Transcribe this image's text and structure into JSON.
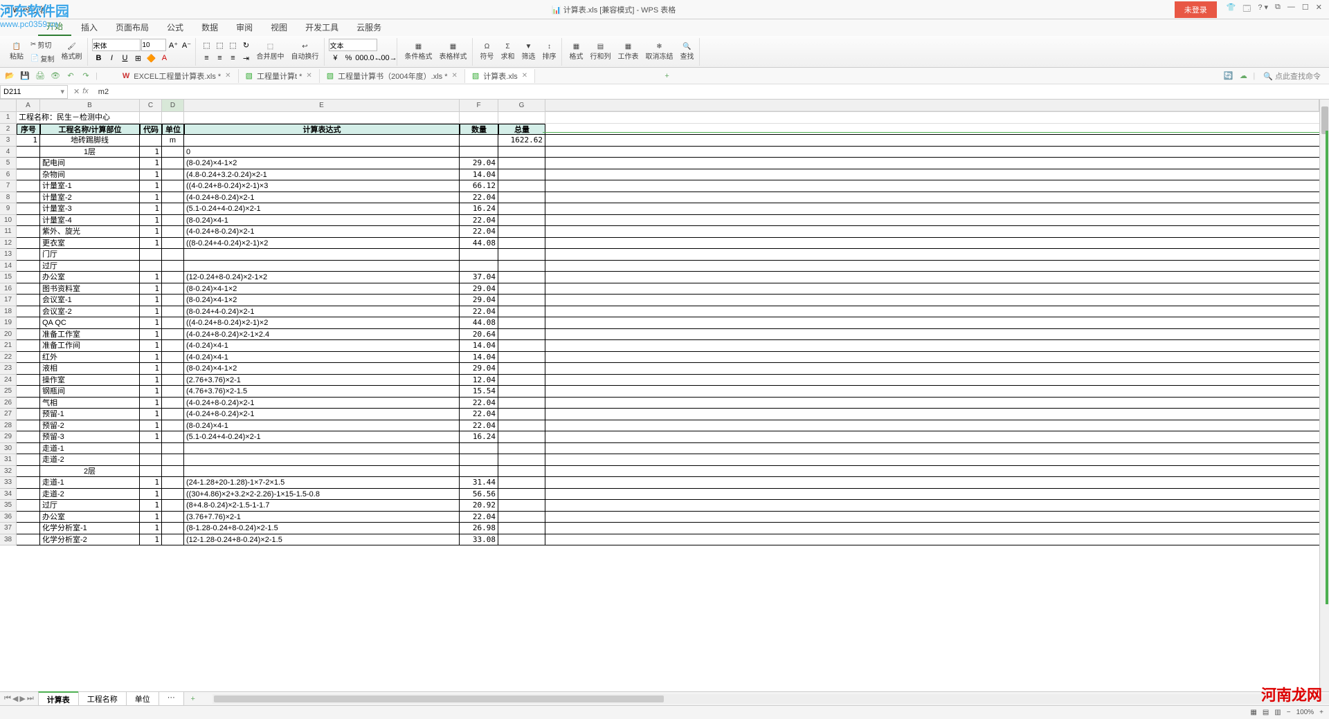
{
  "watermark": "河东软件园",
  "watermark_url": "www.pc0359.cn",
  "watermark_br": "河南龙网",
  "app_label": "WPS 表格",
  "title": "计算表.xls [兼容模式] - WPS 表格",
  "login": "未登录",
  "menutabs": [
    "开始",
    "插入",
    "页面布局",
    "公式",
    "数据",
    "审阅",
    "视图",
    "开发工具",
    "云服务"
  ],
  "menutab_active": 0,
  "ribbon": {
    "paste": "粘贴",
    "cut": "剪切",
    "copy": "复制",
    "fmtpaint": "格式刷",
    "font": "宋体",
    "size": "10",
    "merge": "合并居中",
    "autowrap": "自动换行",
    "general": "文本",
    "cond": "条件格式",
    "tblstyle": "表格样式",
    "symbol": "符号",
    "sum": "求和",
    "filter": "筛选",
    "sort": "排序",
    "format": "格式",
    "rowcol": "行和列",
    "worksheet": "工作表",
    "freeze": "取消冻结",
    "find": "查找"
  },
  "quick_icons": [
    "folder",
    "save",
    "print",
    "preview",
    "undo",
    "redo"
  ],
  "doctabs": [
    {
      "icon": "W",
      "label": "EXCEL工程量计算表.xls *",
      "active": false
    },
    {
      "icon": "S",
      "label": "工程量计算t *",
      "active": false
    },
    {
      "icon": "S",
      "label": "工程量计算书（2004年度）.xls *",
      "active": false
    },
    {
      "icon": "S",
      "label": "计算表.xls",
      "active": true
    }
  ],
  "search_placeholder": "点此查找命令",
  "namebox": "D211",
  "formula": "m2",
  "cols": [
    "A",
    "B",
    "C",
    "D",
    "E",
    "F",
    "G"
  ],
  "headers": {
    "A": "序号",
    "B": "工程名称/计算部位",
    "C": "代码",
    "D": "单位",
    "E": "计算表达式",
    "F": "数量",
    "G": "总量"
  },
  "title_row": "工程名称：民生－检测中心",
  "rows": [
    {
      "n": 3,
      "A": "1",
      "B": "地砖踢脚线",
      "D": "m",
      "E": "",
      "G": "1622.62"
    },
    {
      "n": 4,
      "B": "1层",
      "C": "1",
      "E": "0"
    },
    {
      "n": 5,
      "B": "配电间",
      "C": "1",
      "E": "(8-0.24)×4-1×2",
      "F": "29.04"
    },
    {
      "n": 6,
      "B": "杂物间",
      "C": "1",
      "E": "(4.8-0.24+3.2-0.24)×2-1",
      "F": "14.04"
    },
    {
      "n": 7,
      "B": "计量室-1",
      "C": "1",
      "E": "((4-0.24+8-0.24)×2-1)×3",
      "F": "66.12"
    },
    {
      "n": 8,
      "B": "计量室-2",
      "C": "1",
      "E": "(4-0.24+8-0.24)×2-1",
      "F": "22.04"
    },
    {
      "n": 9,
      "B": "计量室-3",
      "C": "1",
      "E": "(5.1-0.24+4-0.24)×2-1",
      "F": "16.24"
    },
    {
      "n": 10,
      "B": "计量室-4",
      "C": "1",
      "E": "(8-0.24)×4-1",
      "F": "22.04"
    },
    {
      "n": 11,
      "B": "紫外、旋光",
      "C": "1",
      "E": "(4-0.24+8-0.24)×2-1",
      "F": "22.04"
    },
    {
      "n": 12,
      "B": "更衣室",
      "C": "1",
      "E": "((8-0.24+4-0.24)×2-1)×2",
      "F": "44.08"
    },
    {
      "n": 13,
      "B": "门厅"
    },
    {
      "n": 14,
      "B": "过厅"
    },
    {
      "n": 15,
      "B": "办公室",
      "C": "1",
      "E": "(12-0.24+8-0.24)×2-1×2",
      "F": "37.04"
    },
    {
      "n": 16,
      "B": "图书资料室",
      "C": "1",
      "E": "(8-0.24)×4-1×2",
      "F": "29.04"
    },
    {
      "n": 17,
      "B": "会议室-1",
      "C": "1",
      "E": "(8-0.24)×4-1×2",
      "F": "29.04"
    },
    {
      "n": 18,
      "B": "会议室-2",
      "C": "1",
      "E": "(8-0.24+4-0.24)×2-1",
      "F": "22.04"
    },
    {
      "n": 19,
      "B": "QA QC",
      "C": "1",
      "E": "((4-0.24+8-0.24)×2-1)×2",
      "F": "44.08"
    },
    {
      "n": 20,
      "B": "准备工作室",
      "C": "1",
      "E": "(4-0.24+8-0.24)×2-1×2.4",
      "F": "20.64"
    },
    {
      "n": 21,
      "B": "准备工作间",
      "C": "1",
      "E": "(4-0.24)×4-1",
      "F": "14.04"
    },
    {
      "n": 22,
      "B": "红外",
      "C": "1",
      "E": "(4-0.24)×4-1",
      "F": "14.04"
    },
    {
      "n": 23,
      "B": "液相",
      "C": "1",
      "E": "(8-0.24)×4-1×2",
      "F": "29.04"
    },
    {
      "n": 24,
      "B": "操作室",
      "C": "1",
      "E": "(2.76+3.76)×2-1",
      "F": "12.04"
    },
    {
      "n": 25,
      "B": "钢瓶间",
      "C": "1",
      "E": "(4.76+3.76)×2-1.5",
      "F": "15.54"
    },
    {
      "n": 26,
      "B": "气相",
      "C": "1",
      "E": "(4-0.24+8-0.24)×2-1",
      "F": "22.04"
    },
    {
      "n": 27,
      "B": "预留-1",
      "C": "1",
      "E": "(4-0.24+8-0.24)×2-1",
      "F": "22.04"
    },
    {
      "n": 28,
      "B": "预留-2",
      "C": "1",
      "E": "(8-0.24)×4-1",
      "F": "22.04"
    },
    {
      "n": 29,
      "B": "预留-3",
      "C": "1",
      "E": "(5.1-0.24+4-0.24)×2-1",
      "F": "16.24"
    },
    {
      "n": 30,
      "B": "走道-1"
    },
    {
      "n": 31,
      "B": "走道-2"
    },
    {
      "n": 32,
      "B": "2层"
    },
    {
      "n": 33,
      "B": "走道-1",
      "C": "1",
      "E": "(24-1.28+20-1.28)-1×7-2×1.5",
      "F": "31.44"
    },
    {
      "n": 34,
      "B": "走道-2",
      "C": "1",
      "E": "((30+4.86)×2+3.2×2-2.26)-1×15-1.5-0.8",
      "F": "56.56"
    },
    {
      "n": 35,
      "B": "过厅",
      "C": "1",
      "E": "(8+4.8-0.24)×2-1.5-1-1.7",
      "F": "20.92"
    },
    {
      "n": 36,
      "B": "办公室",
      "C": "1",
      "E": "(3.76+7.76)×2-1",
      "F": "22.04"
    },
    {
      "n": 37,
      "B": "化学分析室-1",
      "C": "1",
      "E": "(8-1.28-0.24+8-0.24)×2-1.5",
      "F": "26.98"
    },
    {
      "n": 38,
      "B": "化学分析室-2",
      "C": "1",
      "E": "(12-1.28-0.24+8-0.24)×2-1.5",
      "F": "33.08"
    }
  ],
  "sheettabs": [
    "计算表",
    "工程名称",
    "单位",
    "···"
  ],
  "sheettab_active": 0,
  "zoom": "100%"
}
